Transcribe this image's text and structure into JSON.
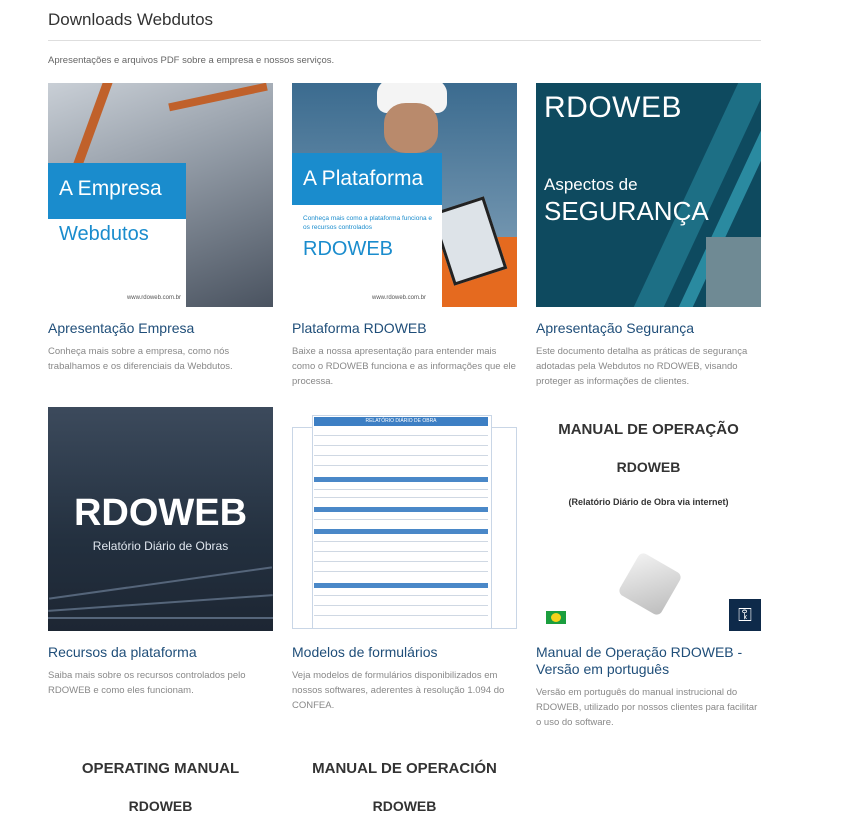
{
  "header": {
    "title": "Downloads Webdutos",
    "subtitle": "Apresentações e arquivos PDF sobre a empresa e nossos serviços."
  },
  "cards": [
    {
      "title": "Apresentação Empresa",
      "description": "Conheça mais sobre a empresa, como nós trabalhamos e os diferenciais da Webdutos.",
      "thumb": {
        "heading": "A Empresa",
        "sub": "Webdutos",
        "url": "www.rdoweb.com.br"
      }
    },
    {
      "title": "Plataforma RDOWEB",
      "description": "Baixe a nossa apresentação para entender mais como o RDOWEB funciona e as informações que ele processa.",
      "thumb": {
        "heading": "A Plataforma",
        "small": "Conheça mais como a plataforma funciona e os recursos controlados",
        "big": "RDOWEB",
        "url": "www.rdoweb.com.br"
      }
    },
    {
      "title": "Apresentação Segurança",
      "description": "Este documento detalha as práticas de segurança adotadas pela Webdutos no RDOWEB, visando proteger as informações de clientes.",
      "thumb": {
        "heading": "RDOWEB",
        "line1": "Aspectos de",
        "line2": "SEGURANÇA"
      }
    },
    {
      "title": "Recursos da plataforma",
      "description": "Saiba mais sobre os recursos controlados pelo RDOWEB e como eles funcionam.",
      "thumb": {
        "heading": "RDOWEB",
        "sub": "Relatório Diário de Obras"
      }
    },
    {
      "title": "Modelos de formulários",
      "description": "Veja modelos de formulários disponibilizados em nossos softwares, aderentes à resolução 1.094 do CONFEA.",
      "thumb": {
        "heading": "RELATÓRIO DIÁRIO DE OBRA"
      }
    },
    {
      "title": "Manual de Operação RDOWEB - Versão em português",
      "description": "Versão em português do manual instrucional do RDOWEB, utilizado por nossos clientes para facilitar o uso do software.",
      "thumb": {
        "line1": "MANUAL DE OPERAÇÃO",
        "line2": "RDOWEB",
        "line3": "(Relatório Diário de Obra via internet)"
      }
    }
  ],
  "partials": [
    {
      "line1": "OPERATING MANUAL",
      "line2": "RDOWEB"
    },
    {
      "line1": "MANUAL DE OPERACIÓN",
      "line2": "RDOWEB"
    }
  ],
  "colors": {
    "accent": "#1a8ccd",
    "link": "#1f4e79",
    "muted": "#888888"
  }
}
